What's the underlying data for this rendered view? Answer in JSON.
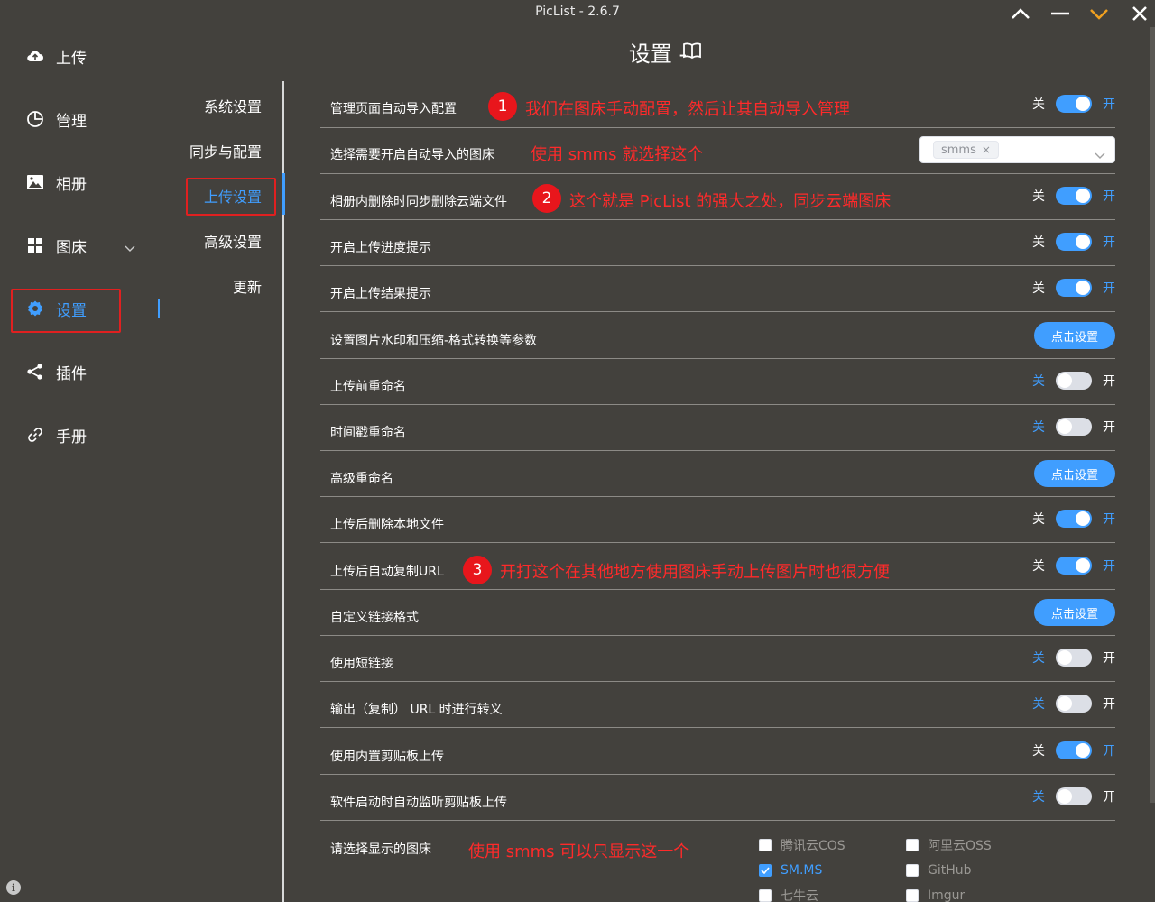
{
  "window": {
    "title": "PicList - 2.6.7"
  },
  "sidebar": {
    "items": [
      {
        "label": "上传",
        "icon": "upload-cloud-icon"
      },
      {
        "label": "管理",
        "icon": "pie-chart-icon"
      },
      {
        "label": "相册",
        "icon": "image-icon"
      },
      {
        "label": "图床",
        "icon": "grid-icon"
      },
      {
        "label": "设置",
        "icon": "gear-icon"
      },
      {
        "label": "插件",
        "icon": "share-icon"
      },
      {
        "label": "手册",
        "icon": "link-icon"
      }
    ]
  },
  "submenu": {
    "items": [
      "系统设置",
      "同步与配置",
      "上传设置",
      "高级设置",
      "更新"
    ]
  },
  "header": {
    "title": "设置 -"
  },
  "switch_labels": {
    "off": "关",
    "on": "开"
  },
  "rows": [
    {
      "label": "管理页面自动导入配置",
      "state": "on"
    },
    {
      "label": "选择需要开启自动导入的图床",
      "select_tag": "smms"
    },
    {
      "label": "相册内删除时同步删除云端文件",
      "state": "on"
    },
    {
      "label": "开启上传进度提示",
      "state": "on"
    },
    {
      "label": "开启上传结果提示",
      "state": "on"
    },
    {
      "label": "设置图片水印和压缩-格式转换等参数",
      "button": "点击设置"
    },
    {
      "label": "上传前重命名",
      "state": "off"
    },
    {
      "label": "时间戳重命名",
      "state": "off"
    },
    {
      "label": "高级重命名",
      "button": "点击设置"
    },
    {
      "label": "上传后删除本地文件",
      "state": "on"
    },
    {
      "label": "上传后自动复制URL",
      "state": "on"
    },
    {
      "label": "自定义链接格式",
      "button": "点击设置"
    },
    {
      "label": "使用短链接",
      "state": "off"
    },
    {
      "label": "输出（复制） URL 时进行转义",
      "state": "off"
    },
    {
      "label": "使用内置剪贴板上传",
      "state": "on"
    },
    {
      "label": "软件启动时自动监听剪贴板上传",
      "state": "off"
    },
    {
      "label": "请选择显示的图床"
    }
  ],
  "annotations": [
    {
      "badge": "1",
      "text": "我们在图床手动配置，然后让其自动导入管理"
    },
    {
      "text": "使用 smms 就选择这个"
    },
    {
      "badge": "2",
      "text": "这个就是 PicList 的强大之处，同步云端图床"
    },
    {
      "badge": "3",
      "text": "开打这个在其他地方使用图床手动上传图片时也很方便"
    },
    {
      "text": "使用 smms 可以只显示这一个"
    }
  ],
  "picbeds": [
    {
      "label": "腾讯云COS",
      "checked": false
    },
    {
      "label": "阿里云OSS",
      "checked": false
    },
    {
      "label": "SM.MS",
      "checked": true
    },
    {
      "label": "GitHub",
      "checked": false
    },
    {
      "label": "七牛云",
      "checked": false
    },
    {
      "label": "Imgur",
      "checked": false
    }
  ],
  "colors": {
    "accent": "#409eff",
    "annotation": "#ff2a2a",
    "background": "#43413d"
  }
}
